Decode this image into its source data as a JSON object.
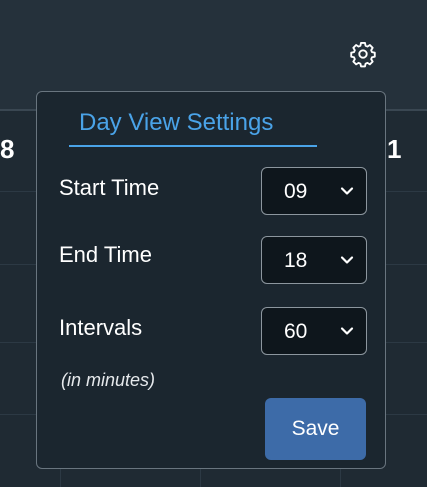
{
  "header": {
    "settings_icon": "gear-icon"
  },
  "calendar": {
    "day_left_label": "8",
    "day_right_label": "1"
  },
  "day_view_settings": {
    "title": "Day View Settings",
    "start_time": {
      "label": "Start Time",
      "value": "09"
    },
    "end_time": {
      "label": "End Time",
      "value": "18"
    },
    "intervals": {
      "label": "Intervals",
      "unit_note": "(in minutes)",
      "value": "60"
    },
    "save_label": "Save"
  },
  "colors": {
    "accent": "#4aa3e8",
    "button": "#3d6ba8",
    "panel": "#1b262f",
    "background": "#1f2a33"
  }
}
